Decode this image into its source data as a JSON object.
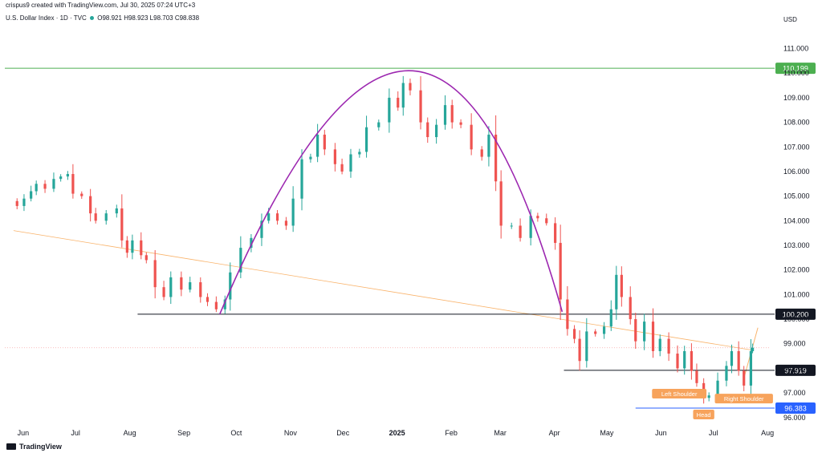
{
  "header": {
    "caption": "crispus9 created with TradingView.com, Jul 30, 2025 07:24 UTC+3",
    "symbol": "U.S. Dollar Index · 1D · TVC",
    "ohlc_o": "O98.921",
    "ohlc_h": "H98.923",
    "ohlc_l": "L98.703",
    "ohlc_c": "C98.838"
  },
  "footer": {
    "brand": "TradingView"
  },
  "colors": {
    "up": "#26a69a",
    "down": "#ef5350",
    "arc": "#9c27b0",
    "resistance": "#4caf50",
    "level": "#131722",
    "support_low": "#2962ff",
    "annotation": "#f7a35c",
    "trend": "#f9b36b",
    "current": "#f7a6a8"
  },
  "chart_data": {
    "type": "candlestick",
    "currency": "USD",
    "ylim": [
      95.7,
      111.8
    ],
    "y_ticks": [
      "111.000",
      "110.000",
      "109.000",
      "108.000",
      "107.000",
      "106.000",
      "105.000",
      "104.000",
      "103.000",
      "102.000",
      "101.000",
      "100.000",
      "99.000",
      "98.000",
      "97.000",
      "96.000"
    ],
    "x_ticks": [
      "Jun",
      "Jul",
      "Aug",
      "Sep",
      "Oct",
      "Nov",
      "Dec",
      "2025",
      "Feb",
      "Mar",
      "Apr",
      "May",
      "Jun",
      "Jul",
      "Aug"
    ],
    "levels": [
      {
        "value": 110.199,
        "label": "110.199",
        "color": "#4caf50"
      },
      {
        "value": 100.2,
        "label": "100.200",
        "color": "#131722"
      },
      {
        "value": 97.919,
        "label": "97.919",
        "color": "#131722"
      },
      {
        "value": 96.383,
        "label": "96.383",
        "color": "#2962ff"
      }
    ],
    "annotations": [
      {
        "text": "Left Shoulder",
        "date": "2025-06-17",
        "price": 97.2
      },
      {
        "text": "Head",
        "date": "2025-07-01",
        "price": 96.35
      },
      {
        "text": "Right Shoulder",
        "date": "2025-07-24",
        "price": 97.0
      }
    ],
    "arc": {
      "start": [
        "2024-09-27",
        100.2
      ],
      "peak": [
        "2025-01-13",
        110.1
      ],
      "end": [
        "2025-04-11",
        100.3
      ]
    },
    "trendline": {
      "from": [
        "2024-06-01",
        103.6
      ],
      "to": [
        "2025-07-28",
        98.75
      ]
    },
    "neckline_rise": {
      "from": [
        "2025-07-24",
        97.6
      ],
      "to": [
        "2025-08-01",
        99.65
      ]
    },
    "last_close": 98.838,
    "closes": [
      {
        "date": "2024-06-03",
        "close": 104.6
      },
      {
        "date": "2024-06-07",
        "close": 104.9
      },
      {
        "date": "2024-06-11",
        "close": 105.2
      },
      {
        "date": "2024-06-14",
        "close": 105.5
      },
      {
        "date": "2024-06-19",
        "close": 105.3
      },
      {
        "date": "2024-06-24",
        "close": 105.7
      },
      {
        "date": "2024-06-28",
        "close": 105.8
      },
      {
        "date": "2024-07-02",
        "close": 105.9
      },
      {
        "date": "2024-07-05",
        "close": 105.1
      },
      {
        "date": "2024-07-10",
        "close": 105.0
      },
      {
        "date": "2024-07-15",
        "close": 104.3
      },
      {
        "date": "2024-07-18",
        "close": 104.0
      },
      {
        "date": "2024-07-24",
        "close": 104.3
      },
      {
        "date": "2024-07-30",
        "close": 104.5
      },
      {
        "date": "2024-08-02",
        "close": 103.2
      },
      {
        "date": "2024-08-05",
        "close": 102.7
      },
      {
        "date": "2024-08-08",
        "close": 103.2
      },
      {
        "date": "2024-08-13",
        "close": 102.6
      },
      {
        "date": "2024-08-16",
        "close": 102.4
      },
      {
        "date": "2024-08-21",
        "close": 101.3
      },
      {
        "date": "2024-08-26",
        "close": 100.9
      },
      {
        "date": "2024-08-30",
        "close": 101.7
      },
      {
        "date": "2024-09-05",
        "close": 101.2
      },
      {
        "date": "2024-09-10",
        "close": 101.5
      },
      {
        "date": "2024-09-16",
        "close": 100.9
      },
      {
        "date": "2024-09-20",
        "close": 100.7
      },
      {
        "date": "2024-09-25",
        "close": 100.4
      },
      {
        "date": "2024-09-30",
        "close": 100.8
      },
      {
        "date": "2024-10-03",
        "close": 101.9
      },
      {
        "date": "2024-10-09",
        "close": 102.9
      },
      {
        "date": "2024-10-15",
        "close": 103.3
      },
      {
        "date": "2024-10-21",
        "close": 104.0
      },
      {
        "date": "2024-10-25",
        "close": 104.3
      },
      {
        "date": "2024-10-30",
        "close": 104.0
      },
      {
        "date": "2024-11-04",
        "close": 103.8
      },
      {
        "date": "2024-11-08",
        "close": 104.9
      },
      {
        "date": "2024-11-13",
        "close": 106.5
      },
      {
        "date": "2024-11-18",
        "close": 106.6
      },
      {
        "date": "2024-11-22",
        "close": 107.5
      },
      {
        "date": "2024-11-26",
        "close": 106.9
      },
      {
        "date": "2024-12-02",
        "close": 106.3
      },
      {
        "date": "2024-12-06",
        "close": 106.0
      },
      {
        "date": "2024-12-11",
        "close": 106.7
      },
      {
        "date": "2024-12-16",
        "close": 106.8
      },
      {
        "date": "2024-12-20",
        "close": 107.8
      },
      {
        "date": "2024-12-27",
        "close": 108.0
      },
      {
        "date": "2025-01-02",
        "close": 109.0
      },
      {
        "date": "2025-01-07",
        "close": 108.6
      },
      {
        "date": "2025-01-10",
        "close": 109.6
      },
      {
        "date": "2025-01-14",
        "close": 109.3
      },
      {
        "date": "2025-01-20",
        "close": 108.0
      },
      {
        "date": "2025-01-24",
        "close": 107.4
      },
      {
        "date": "2025-01-29",
        "close": 107.9
      },
      {
        "date": "2025-02-03",
        "close": 108.7
      },
      {
        "date": "2025-02-07",
        "close": 108.0
      },
      {
        "date": "2025-02-12",
        "close": 107.9
      },
      {
        "date": "2025-02-18",
        "close": 106.9
      },
      {
        "date": "2025-02-24",
        "close": 106.6
      },
      {
        "date": "2025-02-28",
        "close": 107.5
      },
      {
        "date": "2025-03-04",
        "close": 105.6
      },
      {
        "date": "2025-03-07",
        "close": 103.8
      },
      {
        "date": "2025-03-13",
        "close": 103.8
      },
      {
        "date": "2025-03-18",
        "close": 103.3
      },
      {
        "date": "2025-03-24",
        "close": 104.2
      },
      {
        "date": "2025-03-28",
        "close": 104.1
      },
      {
        "date": "2025-04-02",
        "close": 103.9
      },
      {
        "date": "2025-04-07",
        "close": 103.1
      },
      {
        "date": "2025-04-10",
        "close": 100.8
      },
      {
        "date": "2025-04-14",
        "close": 99.6
      },
      {
        "date": "2025-04-18",
        "close": 99.2
      },
      {
        "date": "2025-04-21",
        "close": 98.3
      },
      {
        "date": "2025-04-25",
        "close": 99.5
      },
      {
        "date": "2025-04-30",
        "close": 99.4
      },
      {
        "date": "2025-05-05",
        "close": 99.7
      },
      {
        "date": "2025-05-09",
        "close": 100.4
      },
      {
        "date": "2025-05-12",
        "close": 101.8
      },
      {
        "date": "2025-05-15",
        "close": 100.9
      },
      {
        "date": "2025-05-20",
        "close": 100.0
      },
      {
        "date": "2025-05-23",
        "close": 99.1
      },
      {
        "date": "2025-05-28",
        "close": 99.9
      },
      {
        "date": "2025-06-02",
        "close": 98.7
      },
      {
        "date": "2025-06-06",
        "close": 99.2
      },
      {
        "date": "2025-06-11",
        "close": 98.6
      },
      {
        "date": "2025-06-16",
        "close": 98.0
      },
      {
        "date": "2025-06-20",
        "close": 98.7
      },
      {
        "date": "2025-06-24",
        "close": 97.9
      },
      {
        "date": "2025-06-27",
        "close": 97.4
      },
      {
        "date": "2025-07-01",
        "close": 96.8
      },
      {
        "date": "2025-07-04",
        "close": 96.9
      },
      {
        "date": "2025-07-09",
        "close": 97.5
      },
      {
        "date": "2025-07-14",
        "close": 98.1
      },
      {
        "date": "2025-07-17",
        "close": 98.7
      },
      {
        "date": "2025-07-21",
        "close": 97.9
      },
      {
        "date": "2025-07-24",
        "close": 97.3
      },
      {
        "date": "2025-07-28",
        "close": 98.7
      },
      {
        "date": "2025-07-29",
        "close": 98.838
      }
    ]
  }
}
